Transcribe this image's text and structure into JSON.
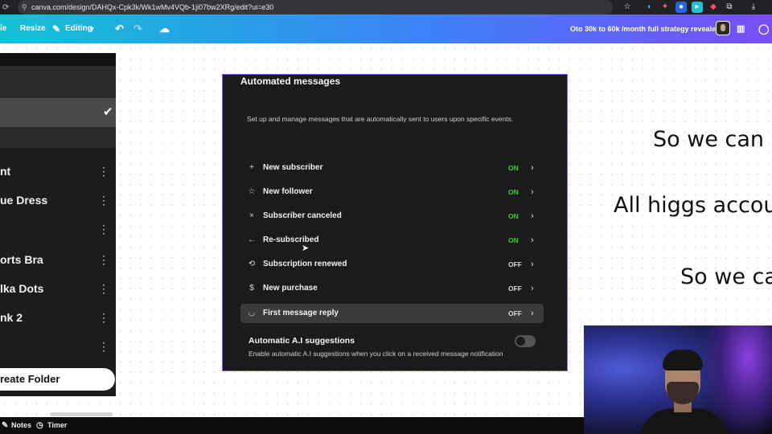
{
  "browser": {
    "url": "canva.com/design/DAHQx-Cpk3k/Wk1wMv4VQb-1ji07bw2XRg/edit?ui=e30",
    "url_icon": "site-info-icon",
    "left_icon": "reload-icon",
    "extension_icons": [
      "star-icon",
      "extension-icon",
      "extension-icon",
      "extension-icon",
      "extension-icon",
      "extension-icon",
      "puzzle-icon",
      "profile-icon",
      "download-icon"
    ]
  },
  "toolbar": {
    "file_label": "le",
    "resize_label": "Resize",
    "editing_label": "Editing",
    "design_title": "Oto 30k to 60k /month full strategy revealed",
    "icons": {
      "editing": "pencil-icon",
      "dropdown": "chevron-down-icon",
      "undo": "undo-icon",
      "redo": "redo-icon",
      "cloud": "cloud-sync-icon",
      "insights": "bar-chart-icon",
      "comments": "comment-icon"
    },
    "gradient": [
      "#12c2d6",
      "#3b82f6",
      "#7a4df5"
    ]
  },
  "sidebar": {
    "items": [
      {
        "label": "nt"
      },
      {
        "label": "ue Dress"
      },
      {
        "label": ""
      },
      {
        "label": "orts Bra"
      },
      {
        "label": "lka Dots"
      },
      {
        "label": "nk 2"
      },
      {
        "label": ""
      }
    ],
    "more_icon": "more-vertical-icon",
    "check_icon": "check-icon",
    "create_folder_label": "reate Folder"
  },
  "panel": {
    "title": "Automated messages",
    "description": "Set up and manage messages that are automatically sent to users upon specific events.",
    "rows": [
      {
        "icon": "plus-icon",
        "glyph": "+",
        "label": "New subscriber",
        "status": "ON",
        "on": true
      },
      {
        "icon": "star-icon",
        "glyph": "☆",
        "label": "New follower",
        "status": "ON",
        "on": true
      },
      {
        "icon": "close-icon",
        "glyph": "×",
        "label": "Subscriber canceled",
        "status": "ON",
        "on": true
      },
      {
        "icon": "arrow-left-icon",
        "glyph": "←",
        "label": "Re-subscribed",
        "status": "ON",
        "on": true
      },
      {
        "icon": "repeat-icon",
        "glyph": "⟲",
        "label": "Subscription renewed",
        "status": "OFF",
        "on": false
      },
      {
        "icon": "dollar-icon",
        "glyph": "$",
        "label": "New purchase",
        "status": "OFF",
        "on": false
      },
      {
        "icon": "shield-icon",
        "glyph": "◡",
        "label": "First message reply",
        "status": "OFF",
        "on": false
      }
    ],
    "chevron_icon": "chevron-right-icon",
    "ai_title": "Automatic A.I suggestions",
    "ai_description": "Enable automatic A.I suggestions when you click on a received message notification",
    "ai_toggle_on": false,
    "colors": {
      "on": "#38d430",
      "border": "#8a5cf6"
    }
  },
  "slide_text": {
    "line1": "So we can",
    "line2": "All higgs accou",
    "line3": "So we ca"
  },
  "bottom_bar": {
    "notes_label": "Notes",
    "timer_label": "Timer",
    "notes_icon": "notes-icon",
    "timer_icon": "timer-icon"
  }
}
